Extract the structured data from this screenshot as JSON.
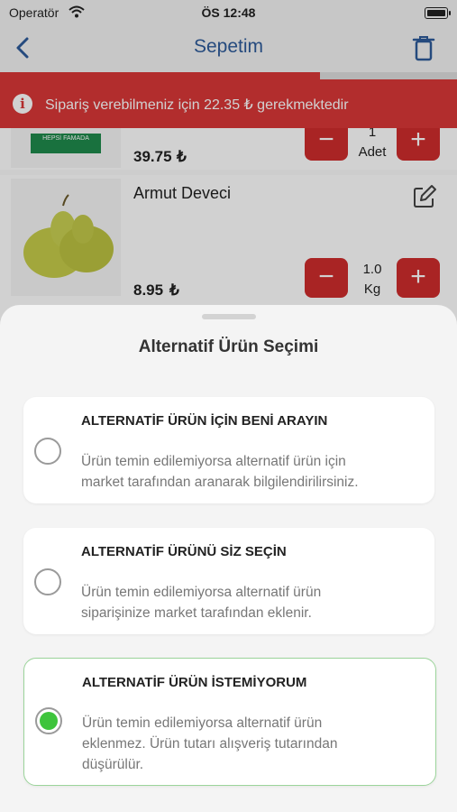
{
  "status_bar": {
    "carrier": "Operatör",
    "time": "ÖS 12:48"
  },
  "nav": {
    "title": "Sepetim"
  },
  "progress": {
    "fraction": 0.7
  },
  "warning": {
    "text": "Sipariş verebilmeniz için 22.35 ₺ gerekmektedir"
  },
  "cart": {
    "items": [
      {
        "name": "",
        "price": "39.75",
        "currency": "₺",
        "qty_value": "1",
        "qty_unit": "Adet",
        "image_text": "HEPSİ FAMADA"
      },
      {
        "name": "Armut Deveci",
        "price": "8.95",
        "currency": "₺",
        "qty_value": "1.0",
        "qty_unit": "Kg"
      }
    ],
    "minus_label": "−",
    "plus_label": "+"
  },
  "sheet": {
    "title": "Alternatif Ürün Seçimi",
    "options": [
      {
        "title": "ALTERNATİF ÜRÜN İÇİN BENİ ARAYIN",
        "line1": "Ürün temin edilemiyorsa alternatif ürün için",
        "line2": "market tarafından aranarak bilgilendirilirsiniz.",
        "line3": "",
        "selected": false
      },
      {
        "title": "ALTERNATİF ÜRÜNÜ SİZ SEÇİN",
        "line1": "Ürün temin edilemiyorsa alternatif ürün",
        "line2": "siparişinize market tarafından eklenir.",
        "line3": "",
        "selected": false
      },
      {
        "title": "ALTERNATİF ÜRÜN İSTEMİYORUM",
        "line1": "Ürün temin edilemiyorsa alternatif ürün",
        "line2": "eklenmez. Ürün tutarı alışveriş tutarından",
        "line3": "düşürülür.",
        "selected": true
      }
    ]
  },
  "colors": {
    "accent_red": "#d93838",
    "nav_blue": "#2e5b9a",
    "selected_green": "#3ec43c"
  }
}
